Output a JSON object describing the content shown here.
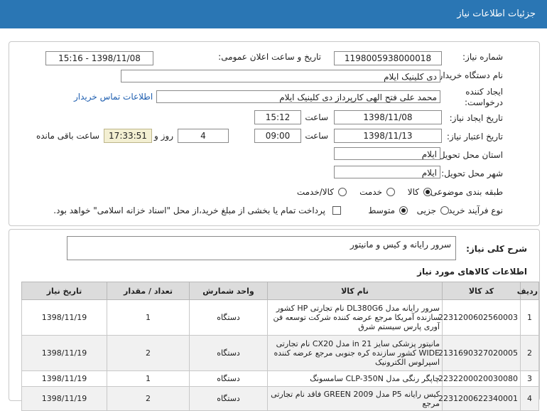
{
  "header": {
    "title": "جزئیات اطلاعات نیاز"
  },
  "form": {
    "need_number_label": "شماره نیاز:",
    "need_number": "1198005938000018",
    "announce_label": "تاریخ و ساعت اعلان عمومی:",
    "announce_value": "1398/11/08 - 15:16",
    "buyer_org_label": "نام دستگاه خریدار:",
    "buyer_org": "دی کلینیک ایلام",
    "creator_label_1": "ایجاد کننده",
    "creator_label_2": "درخواست:",
    "creator": "محمد علی  فتح الهی کارپرداز دی کلینیک ایلام",
    "contact_link": "اطلاعات تماس خریدار",
    "create_date_label": "تاریخ ایجاد نیاز:",
    "create_date": "1398/11/08",
    "time_label": "ساعت",
    "create_time": "15:12",
    "valid_date_label": "تاریخ اعتبار نیاز:",
    "valid_date": "1398/11/13",
    "valid_time": "09:00",
    "days_remaining": "4",
    "days_label": "روز و",
    "countdown": "17:33:51",
    "remaining_label": "ساعت باقی مانده",
    "province_label": "استان محل تحویل:",
    "province": "ایلام",
    "city_label": "شهر محل تحویل:",
    "city": "ایلام",
    "category_label": "طبقه بندی موضوعی:",
    "category_options": [
      "کالا",
      "خدمت",
      "کالا/خدمت"
    ],
    "purchase_type_label": "نوع فرآیند خرید :",
    "purchase_options": [
      "جزیی",
      "متوسط"
    ],
    "payment_note": "پرداخت تمام یا بخشی از مبلغ خرید،از محل \"اسناد خزانه اسلامی\" خواهد بود."
  },
  "description": {
    "label": "شرح کلی نیاز:",
    "text": "سرور رایانه و کیس و مانیتور"
  },
  "items_section": {
    "title": "اطلاعات کالاهای مورد نیاز"
  },
  "table": {
    "headers": [
      "ردیف",
      "کد کالا",
      "نام کالا",
      "واحد شمارش",
      "تعداد / مقدار",
      "تاریخ نیاز"
    ],
    "rows": [
      {
        "row": "1",
        "code": "2231200602560003",
        "name": "سرور رایانه مدل DL380G6 نام تجارتی HP کشور سازنده آمریکا مرجع عرضه کننده شرکت توسعه فن آوری پارس سیستم شرق",
        "unit": "دستگاه",
        "qty": "1",
        "date": "1398/11/19"
      },
      {
        "row": "2",
        "code": "2131690327020005",
        "name": "مانیتور پزشکی سایز 21 in مدل CX20 نام تجارتی WIDE کشور سازنده کره جنوبی مرجع عرضه کننده اسپرلوس الکترونیک",
        "unit": "دستگاه",
        "qty": "2",
        "date": "1398/11/19"
      },
      {
        "row": "3",
        "code": "2232200020030080",
        "name": "چاپگر رنگی مدل CLP-350N سامسونگ",
        "unit": "دستگاه",
        "qty": "1",
        "date": "1398/11/19"
      },
      {
        "row": "4",
        "code": "2231200622340001",
        "name": "کیس رایانه P5 مدل GREEN 2009 فاقد نام تجارتی مرجع",
        "unit": "دستگاه",
        "qty": "2",
        "date": "1398/11/19"
      }
    ]
  },
  "colors": {
    "header_bg": "#2a76b4",
    "link": "#1f5fb0",
    "timer_bg": "#f3efd2"
  }
}
